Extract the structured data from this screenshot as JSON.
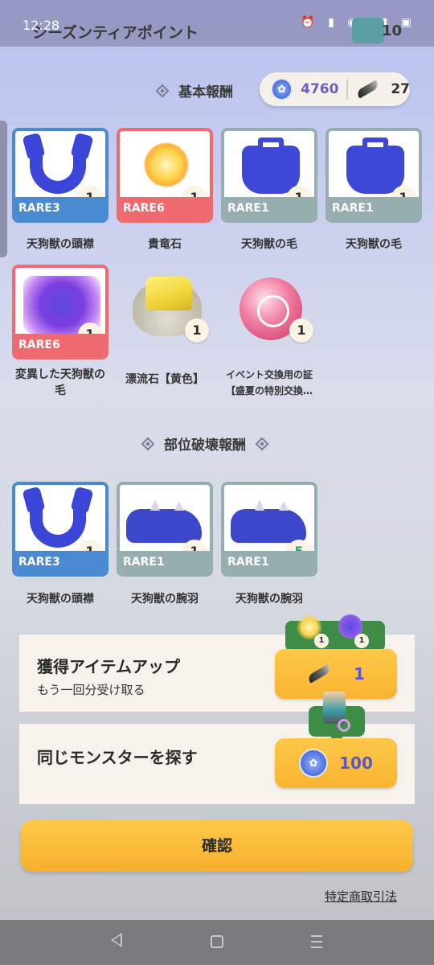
{
  "status": {
    "time": "12:28"
  },
  "header": {
    "title": "シーズンティアポイント",
    "count": "10"
  },
  "currency": {
    "paw_points": "4760",
    "feathers": "27"
  },
  "sections": {
    "basic": "基本報酬",
    "breakage": "部位破壊報酬"
  },
  "basic_rewards": [
    {
      "name": "天狗獣の頭襟",
      "rarity": "RARE3",
      "qty": "1"
    },
    {
      "name": "貴竜石",
      "rarity": "RARE6",
      "qty": "1"
    },
    {
      "name": "天狗獣の毛",
      "rarity": "RARE1",
      "qty": "1"
    },
    {
      "name": "天狗獣の毛",
      "rarity": "RARE1",
      "qty": "1"
    },
    {
      "name_line1": "変異した天狗獣の",
      "name_line2": "毛",
      "rarity": "RARE6",
      "qty": "1"
    },
    {
      "name": "漂流石【黄色】",
      "qty": "1"
    },
    {
      "name_line1": "イベント交換用の証",
      "name_line2": "【盛夏の特別交換…",
      "qty": "1"
    }
  ],
  "breakage_rewards": [
    {
      "name": "天狗獣の頭襟",
      "rarity": "RARE3",
      "qty": "1"
    },
    {
      "name": "天狗獣の腕羽",
      "rarity": "RARE1",
      "qty": "1"
    },
    {
      "name": "天狗獣の腕羽",
      "rarity": "RARE1",
      "qty": "5"
    }
  ],
  "bonus": {
    "item_up": {
      "title": "獲得アイテムアップ",
      "subtitle": "もう一回分受け取る",
      "cost": "1",
      "preview_qty_a": "1",
      "preview_qty_b": "1"
    },
    "same_monster": {
      "title": "同じモンスターを探す",
      "cost": "100"
    }
  },
  "confirm_label": "確認",
  "legal_link": "特定商取引法",
  "colors": {
    "rare3": "#4a8ad1",
    "rare6": "#ef6a6f",
    "rare1": "#97aeb0",
    "button": "#f7b431"
  }
}
